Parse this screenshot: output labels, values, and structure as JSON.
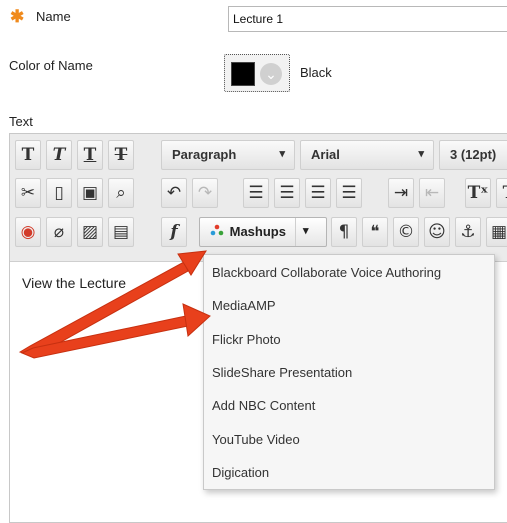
{
  "form": {
    "name_label": "Name",
    "name_value": "Lecture 1",
    "color_label": "Color of Name",
    "color_value": "Black",
    "color_swatch": "#000000",
    "text_label": "Text"
  },
  "toolbar": {
    "row1": {
      "buttons": [
        "T",
        "T",
        "T",
        "T"
      ],
      "paragraph": "Paragraph",
      "font": "Arial",
      "size": "3 (12pt)"
    },
    "mashups_label": "Mashups"
  },
  "editor": {
    "content": "View the Lecture"
  },
  "mashups_menu": {
    "items": [
      "Blackboard Collaborate Voice Authoring",
      "MediaAMP",
      "Flickr Photo",
      "SlideShare Presentation",
      "Add NBC Content",
      "YouTube Video",
      "Digication"
    ]
  },
  "colors": {
    "required": "#f08a1c",
    "arrow": "#e8401c",
    "menu_bg": "#f6f6f6"
  }
}
